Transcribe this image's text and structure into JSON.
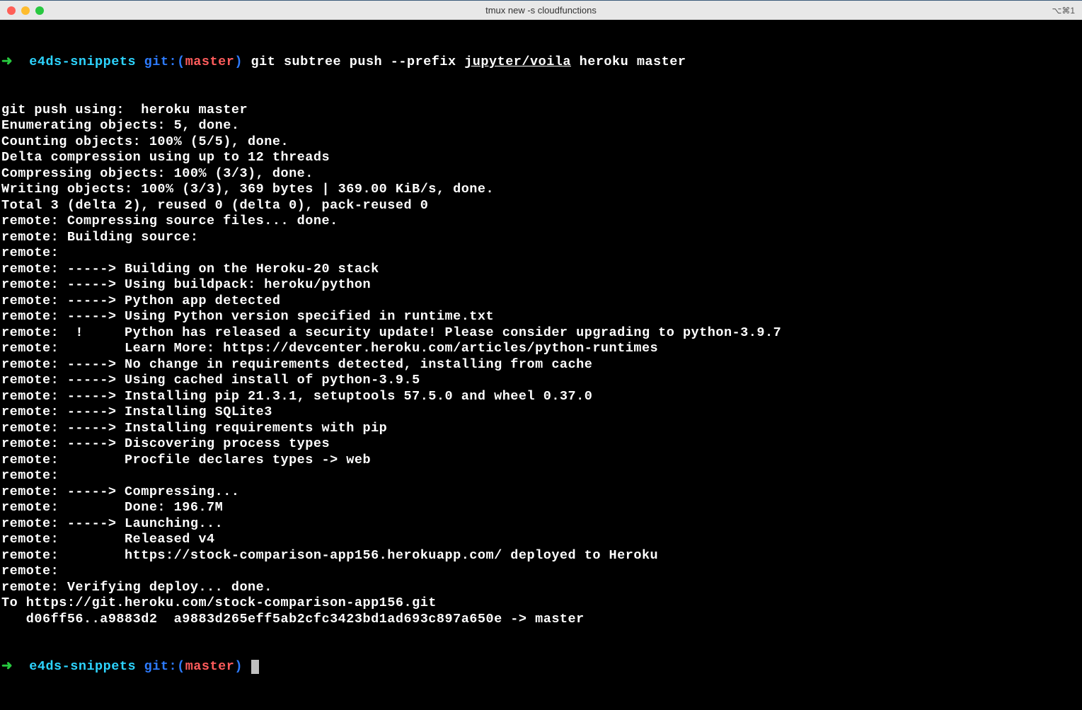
{
  "titlebar": {
    "title": "tmux new -s cloudfunctions",
    "right": "⌥⌘1"
  },
  "prompt": {
    "arrow": "➜",
    "dir": "e4ds-snippets",
    "git_label": "git:(",
    "branch": "master",
    "git_close": ")"
  },
  "command": {
    "cmd_part1": "git subtree push --prefix ",
    "cmd_underline": "jupyter/voila",
    "cmd_part2": " heroku master"
  },
  "output": [
    "git push using:  heroku master",
    "Enumerating objects: 5, done.",
    "Counting objects: 100% (5/5), done.",
    "Delta compression using up to 12 threads",
    "Compressing objects: 100% (3/3), done.",
    "Writing objects: 100% (3/3), 369 bytes | 369.00 KiB/s, done.",
    "Total 3 (delta 2), reused 0 (delta 0), pack-reused 0",
    "remote: Compressing source files... done.",
    "remote: Building source:",
    "remote: ",
    "remote: -----> Building on the Heroku-20 stack",
    "remote: -----> Using buildpack: heroku/python",
    "remote: -----> Python app detected",
    "remote: -----> Using Python version specified in runtime.txt",
    "remote:  !     Python has released a security update! Please consider upgrading to python-3.9.7",
    "remote:        Learn More: https://devcenter.heroku.com/articles/python-runtimes",
    "remote: -----> No change in requirements detected, installing from cache",
    "remote: -----> Using cached install of python-3.9.5",
    "remote: -----> Installing pip 21.3.1, setuptools 57.5.0 and wheel 0.37.0",
    "remote: -----> Installing SQLite3",
    "remote: -----> Installing requirements with pip",
    "remote: -----> Discovering process types",
    "remote:        Procfile declares types -> web",
    "remote: ",
    "remote: -----> Compressing...",
    "remote:        Done: 196.7M",
    "remote: -----> Launching...",
    "remote:        Released v4",
    "remote:        https://stock-comparison-app156.herokuapp.com/ deployed to Heroku",
    "remote: ",
    "remote: Verifying deploy... done.",
    "To https://git.heroku.com/stock-comparison-app156.git",
    "   d06ff56..a9883d2  a9883d265eff5ab2cfc3423bd1ad693c897a650e -> master"
  ]
}
